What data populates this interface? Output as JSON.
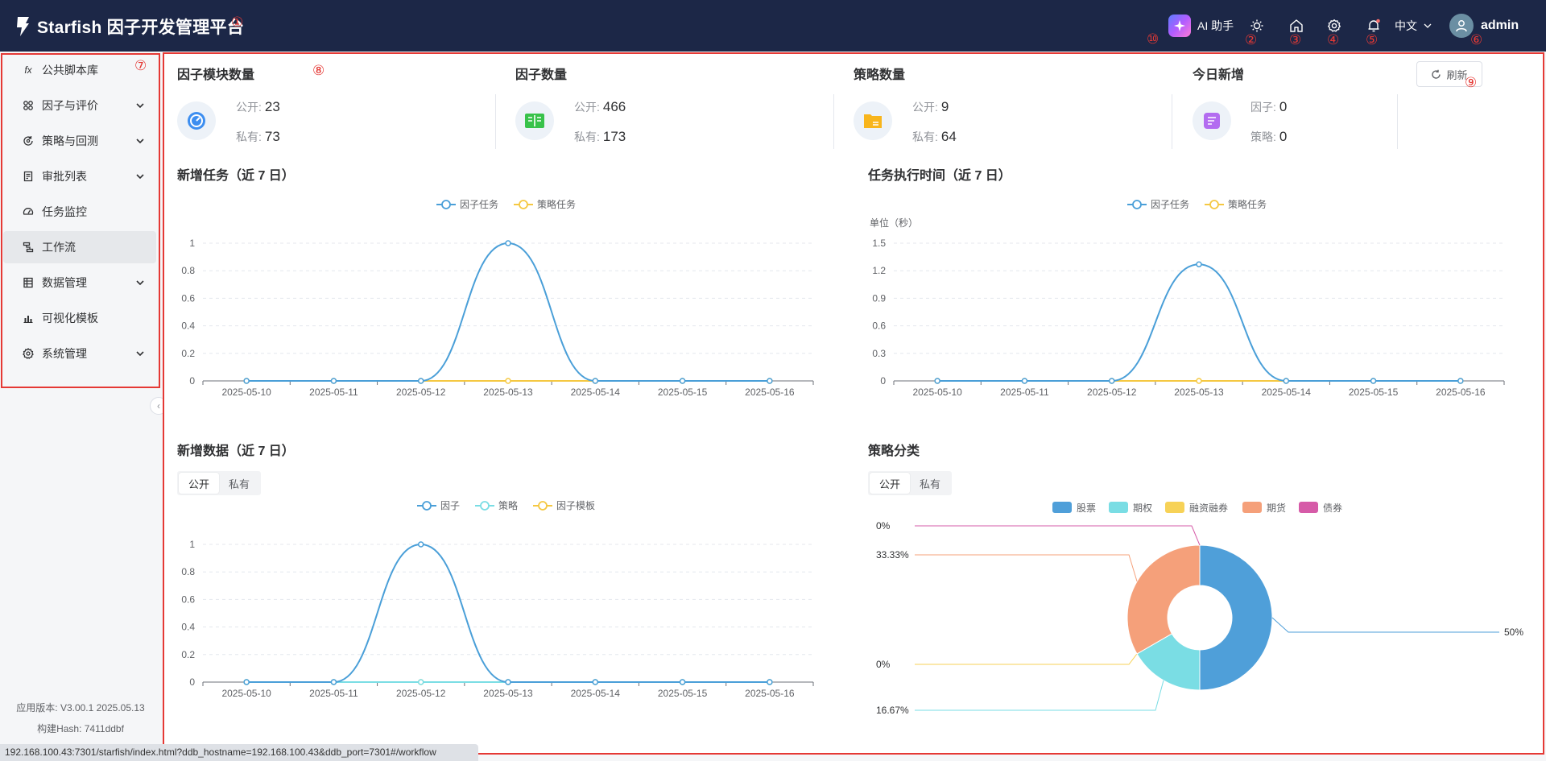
{
  "header": {
    "app_title": "Starfish 因子开发管理平台",
    "ai_label": "AI 助手",
    "language": "中文",
    "user": "admin"
  },
  "annotations": [
    "①",
    "②",
    "③",
    "④",
    "⑤",
    "⑥",
    "⑦",
    "⑧",
    "⑨",
    "⑩"
  ],
  "icons": {
    "theme": "sun-icon",
    "home": "home-icon",
    "settings": "gear-icon",
    "notifications": "bell-icon",
    "ai": "sparkle-icon"
  },
  "sidebar": {
    "items": [
      {
        "label": "公共脚本库",
        "icon": "fx",
        "expandable": false
      },
      {
        "label": "因子与评价",
        "icon": "nodes",
        "expandable": true
      },
      {
        "label": "策略与回测",
        "icon": "cycle",
        "expandable": true
      },
      {
        "label": "审批列表",
        "icon": "doc",
        "expandable": true
      },
      {
        "label": "任务监控",
        "icon": "gauge",
        "expandable": false
      },
      {
        "label": "工作流",
        "icon": "flow",
        "expandable": false,
        "active": true
      },
      {
        "label": "数据管理",
        "icon": "table",
        "expandable": true
      },
      {
        "label": "可视化模板",
        "icon": "chart",
        "expandable": false
      },
      {
        "label": "系统管理",
        "icon": "gear",
        "expandable": true
      }
    ],
    "version": "应用版本: V3.00.1 2025.05.13",
    "build_hash": "构建Hash: 7411ddbf"
  },
  "stats": {
    "modules": {
      "title": "因子模块数量",
      "public_label": "公开:",
      "public": "23",
      "private_label": "私有:",
      "private": "73"
    },
    "factors": {
      "title": "因子数量",
      "public_label": "公开:",
      "public": "466",
      "private_label": "私有:",
      "private": "173"
    },
    "strategies": {
      "title": "策略数量",
      "public_label": "公开:",
      "public": "9",
      "private_label": "私有:",
      "private": "64"
    },
    "today": {
      "title": "今日新增",
      "factor_label": "因子:",
      "factor": "0",
      "strategy_label": "策略:",
      "strategy": "0"
    },
    "refresh_label": "刷新"
  },
  "colors": {
    "accent_blue": "#4a9fd8",
    "accent_yellow": "#f5c842",
    "accent_cyan": "#7adde4",
    "pie_stock": "#4f9fd9",
    "pie_option": "#7adde4",
    "pie_margin": "#f7d257",
    "pie_future": "#f5a07a",
    "pie_bond": "#d65ba8"
  },
  "charts": {
    "new_tasks": {
      "title": "新增任务（近 7 日）"
    },
    "exec_time": {
      "title": "任务执行时间（近 7 日）",
      "unit": "单位（秒）"
    },
    "new_data": {
      "title": "新增数据（近 7 日）",
      "tab_public": "公开",
      "tab_private": "私有"
    },
    "strategy_class": {
      "title": "策略分类",
      "tab_public": "公开",
      "tab_private": "私有"
    }
  },
  "chart_data": [
    {
      "type": "line",
      "title": "新增任务（近 7 日）",
      "x": [
        "2025-05-10",
        "2025-05-11",
        "2025-05-12",
        "2025-05-13",
        "2025-05-14",
        "2025-05-15",
        "2025-05-16"
      ],
      "yticks": [
        "0",
        "0.2",
        "0.4",
        "0.6",
        "0.8",
        "1"
      ],
      "ylim": [
        0,
        1
      ],
      "series": [
        {
          "name": "因子任务",
          "color": "#4a9fd8",
          "values": [
            0,
            0,
            0,
            1,
            0,
            0,
            0
          ]
        },
        {
          "name": "策略任务",
          "color": "#f5c842",
          "values": [
            0,
            0,
            0,
            0,
            0,
            0,
            0
          ]
        }
      ]
    },
    {
      "type": "line",
      "title": "任务执行时间（近 7 日）",
      "ylabel": "单位（秒）",
      "x": [
        "2025-05-10",
        "2025-05-11",
        "2025-05-12",
        "2025-05-13",
        "2025-05-14",
        "2025-05-15",
        "2025-05-16"
      ],
      "yticks": [
        "0",
        "0.3",
        "0.6",
        "0.9",
        "1.2",
        "1.5"
      ],
      "ylim": [
        0,
        1.5
      ],
      "series": [
        {
          "name": "因子任务",
          "color": "#4a9fd8",
          "values": [
            0,
            0,
            0,
            1.27,
            0,
            0,
            0
          ]
        },
        {
          "name": "策略任务",
          "color": "#f5c842",
          "values": [
            0,
            0,
            0,
            0,
            0,
            0,
            0
          ]
        }
      ]
    },
    {
      "type": "line",
      "title": "新增数据（近 7 日）",
      "x": [
        "2025-05-10",
        "2025-05-11",
        "2025-05-12",
        "2025-05-13",
        "2025-05-14",
        "2025-05-15",
        "2025-05-16"
      ],
      "yticks": [
        "0",
        "0.2",
        "0.4",
        "0.6",
        "0.8",
        "1"
      ],
      "ylim": [
        0,
        1
      ],
      "series": [
        {
          "name": "因子",
          "color": "#4a9fd8",
          "values": [
            0,
            0,
            1,
            0,
            0,
            0,
            0
          ]
        },
        {
          "name": "策略",
          "color": "#7adde4",
          "values": [
            0,
            0,
            0,
            0,
            0,
            0,
            0
          ]
        },
        {
          "name": "因子模板",
          "color": "#f5c842",
          "values": [
            0,
            0,
            0,
            0,
            0,
            0,
            0
          ]
        }
      ]
    },
    {
      "type": "pie",
      "title": "策略分类",
      "slices": [
        {
          "name": "股票",
          "value": 50,
          "label": "50%",
          "color": "#4f9fd9"
        },
        {
          "name": "期权",
          "value": 16.67,
          "label": "16.67%",
          "color": "#7adde4"
        },
        {
          "name": "融资融券",
          "value": 0,
          "label": "0%",
          "color": "#f7d257"
        },
        {
          "name": "期货",
          "value": 33.33,
          "label": "33.33%",
          "color": "#f5a07a"
        },
        {
          "name": "债券",
          "value": 0,
          "label": "0%",
          "color": "#d65ba8"
        }
      ]
    }
  ],
  "status_url": "192.168.100.43:7301/starfish/index.html?ddb_hostname=192.168.100.43&ddb_port=7301#/workflow"
}
